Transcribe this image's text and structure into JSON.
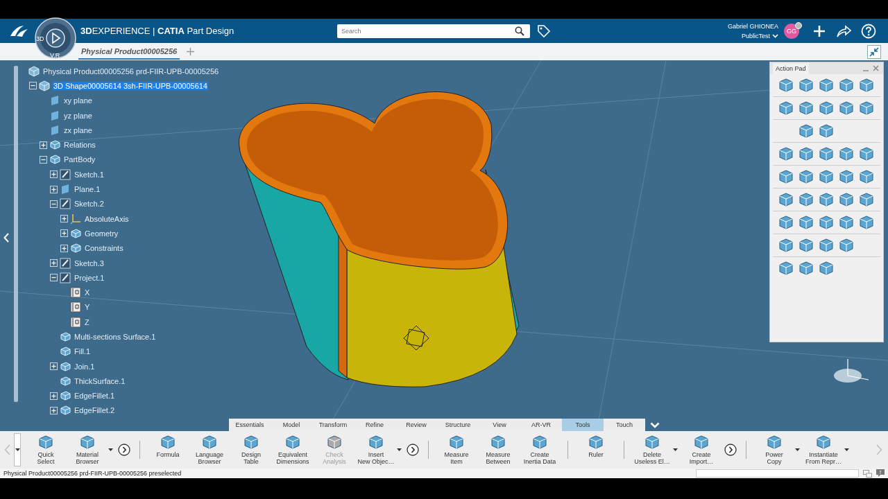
{
  "header": {
    "title": "**3D**EXPERIENCE | **CATIA** Part Design",
    "compass_labels": [
      "3D",
      "V.R"
    ],
    "search": {
      "placeholder": "Search"
    },
    "user": {
      "name": "Gabriel GHIONEA",
      "space": "PublicTest",
      "initials": "GG"
    }
  },
  "tabs": [
    {
      "label": "Physical Product00005256",
      "selected": true
    }
  ],
  "tree": [
    {
      "label": "Physical Product00005256 prd-FIIR-UPB-00005256",
      "kind": "product",
      "selected": false,
      "children": [
        {
          "label": "3D Shape00005614 3sh-FIIR-UPB-00005614",
          "kind": "product",
          "selected": true,
          "expanded": true,
          "children": [
            {
              "label": "xy plane",
              "kind": "plane",
              "selected": false
            },
            {
              "label": "yz plane",
              "kind": "plane",
              "selected": false
            },
            {
              "label": "zx plane",
              "kind": "plane",
              "selected": false
            },
            {
              "label": "Relations",
              "kind": "feature",
              "selected": false,
              "expanded": false
            },
            {
              "label": "PartBody",
              "kind": "feature",
              "selected": false,
              "expanded": true,
              "children": [
                {
                  "label": "Sketch.1",
                  "kind": "sketch",
                  "selected": false,
                  "expanded": false
                },
                {
                  "label": "Plane.1",
                  "kind": "plane",
                  "selected": false,
                  "expanded": false
                },
                {
                  "label": "Sketch.2",
                  "kind": "sketch",
                  "selected": false,
                  "expanded": true,
                  "children": [
                    {
                      "label": "AbsoluteAxis",
                      "kind": "axis",
                      "selected": false,
                      "expanded": false
                    },
                    {
                      "label": "Geometry",
                      "kind": "feature",
                      "selected": false,
                      "expanded": false
                    },
                    {
                      "label": "Constraints",
                      "kind": "feature",
                      "selected": false,
                      "expanded": false
                    }
                  ]
                },
                {
                  "label": "Sketch.3",
                  "kind": "sketch",
                  "selected": false,
                  "expanded": false
                },
                {
                  "label": "Project.1",
                  "kind": "sketch",
                  "selected": false,
                  "expanded": true,
                  "children": [
                    {
                      "label": "X",
                      "kind": "parameter",
                      "selected": false
                    },
                    {
                      "label": "Y",
                      "kind": "parameter",
                      "selected": false
                    },
                    {
                      "label": "Z",
                      "kind": "parameter",
                      "selected": false
                    }
                  ]
                },
                {
                  "label": "Multi-sections Surface.1",
                  "kind": "feature",
                  "selected": false
                },
                {
                  "label": "Fill.1",
                  "kind": "feature",
                  "selected": false
                },
                {
                  "label": "Join.1",
                  "kind": "feature",
                  "selected": false,
                  "expanded": false
                },
                {
                  "label": "ThickSurface.1",
                  "kind": "feature",
                  "selected": false
                },
                {
                  "label": "EdgeFillet.1",
                  "kind": "feature",
                  "selected": false,
                  "expanded": false
                },
                {
                  "label": "EdgeFillet.2",
                  "kind": "feature",
                  "selected": false,
                  "expanded": false
                }
              ]
            }
          ]
        }
      ]
    }
  ],
  "action_pad": {
    "title": "Action Pad"
  },
  "workbench_tabs": [
    {
      "label": "Essentials",
      "selected": false
    },
    {
      "label": "Model",
      "selected": false
    },
    {
      "label": "Transform",
      "selected": false
    },
    {
      "label": "Refine",
      "selected": false
    },
    {
      "label": "Review",
      "selected": false
    },
    {
      "label": "Structure",
      "selected": false
    },
    {
      "label": "View",
      "selected": false
    },
    {
      "label": "AR-VR",
      "selected": false
    },
    {
      "label": "Tools",
      "selected": true
    },
    {
      "label": "Touch",
      "selected": false
    }
  ],
  "toolbar": [
    {
      "kind": "tool",
      "label": "Quick\nSelect",
      "menu": false,
      "disabled": false
    },
    {
      "kind": "tool",
      "label": "Material\nBrowser",
      "menu": true,
      "disabled": false
    },
    {
      "kind": "more"
    },
    {
      "kind": "separator"
    },
    {
      "kind": "tool",
      "label": "Formula",
      "menu": false,
      "disabled": false
    },
    {
      "kind": "tool",
      "label": "Language\nBrowser",
      "menu": false,
      "disabled": false
    },
    {
      "kind": "tool",
      "label": "Design\nTable",
      "menu": false,
      "disabled": false
    },
    {
      "kind": "tool",
      "label": "Equivalent\nDimensions",
      "menu": false,
      "disabled": false
    },
    {
      "kind": "tool",
      "label": "Check\nAnalysis",
      "menu": false,
      "disabled": true
    },
    {
      "kind": "tool",
      "label": "Insert\nNew Objec…",
      "menu": true,
      "disabled": false
    },
    {
      "kind": "more"
    },
    {
      "kind": "separator"
    },
    {
      "kind": "tool",
      "label": "Measure\nItem",
      "menu": false,
      "disabled": false
    },
    {
      "kind": "tool",
      "label": "Measure\nBetween",
      "menu": false,
      "disabled": false
    },
    {
      "kind": "tool",
      "label": "Create\nInertia Data",
      "menu": false,
      "disabled": false
    },
    {
      "kind": "separator"
    },
    {
      "kind": "tool",
      "label": "Ruler",
      "menu": false,
      "disabled": false
    },
    {
      "kind": "separator"
    },
    {
      "kind": "tool",
      "label": "Delete\nUseless El…",
      "menu": true,
      "disabled": false
    },
    {
      "kind": "tool",
      "label": "Create\nImport…",
      "menu": false,
      "disabled": false
    },
    {
      "kind": "more"
    },
    {
      "kind": "separator"
    },
    {
      "kind": "tool",
      "label": "Power\nCopy",
      "menu": true,
      "disabled": false
    },
    {
      "kind": "tool",
      "label": "Instantiate\nFrom Repr…",
      "menu": true,
      "disabled": false
    }
  ],
  "status_bar": {
    "message": "Physical Product00005256 prd-FIIR-UPB-00005256 preselected"
  }
}
